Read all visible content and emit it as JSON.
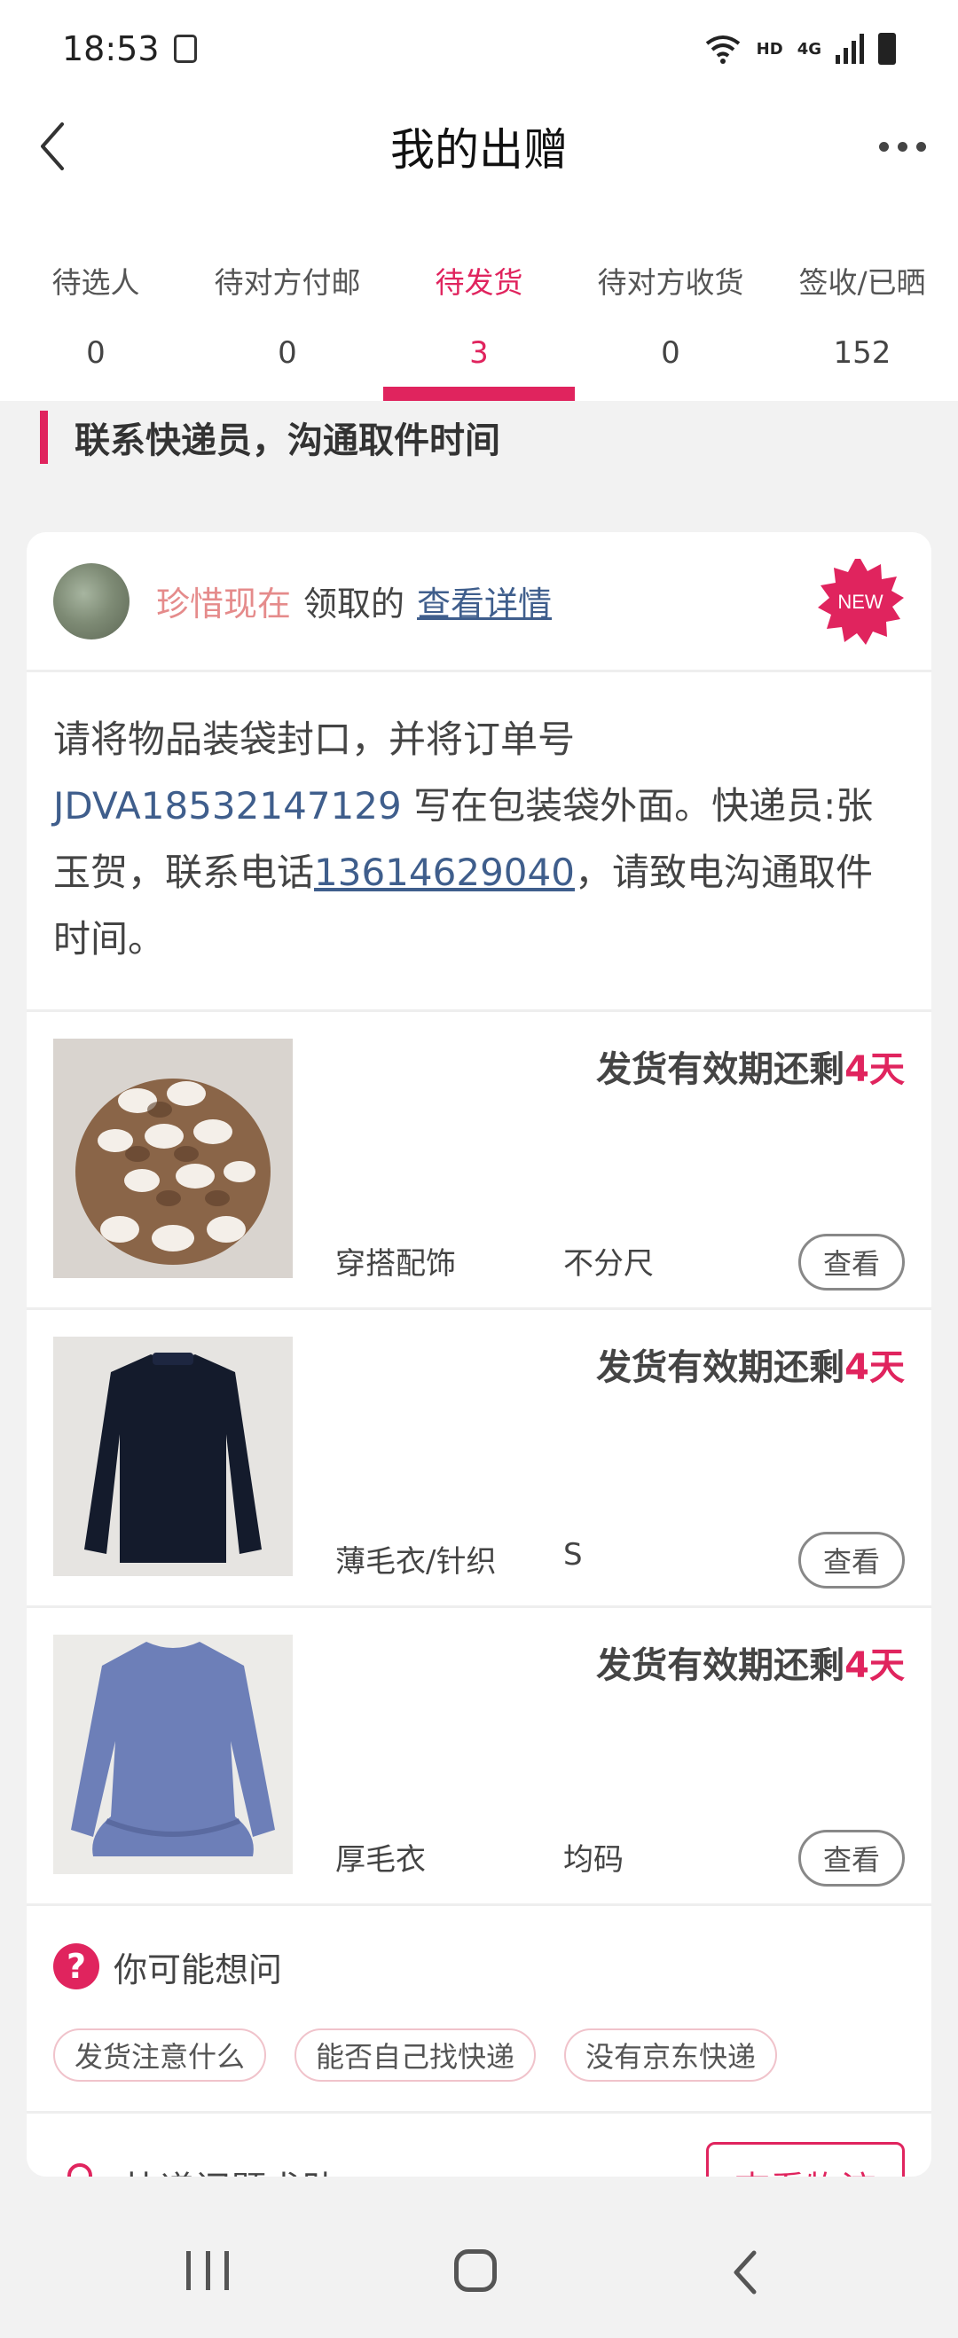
{
  "status_bar": {
    "time": "18:53",
    "hd": "HD",
    "network": "4G"
  },
  "header": {
    "title": "我的出赠"
  },
  "tabs": [
    {
      "label": "待选人",
      "count": "0"
    },
    {
      "label": "待对方付邮",
      "count": "0"
    },
    {
      "label": "待发货",
      "count": "3"
    },
    {
      "label": "待对方收货",
      "count": "0"
    },
    {
      "label": "签收/已晒",
      "count": "152"
    }
  ],
  "section": {
    "title": "联系快递员，沟通取件时间"
  },
  "card": {
    "giver_name": "珍惜现在",
    "giver_verb": "领取的",
    "detail_link": "查看详情",
    "new_badge": "NEW",
    "instruction": {
      "part1": "请将物品装袋封口，并将订单号 ",
      "order_no": "JDVA18532147129",
      "part2": " 写在包装袋外面。快递员:张玉贺，联系电话",
      "phone": "13614629040",
      "part3": "，请致电沟通取件时间。"
    },
    "items": [
      {
        "deadline_prefix": "发货有效期还剩",
        "deadline_days": "4天",
        "category": "穿搭配饰",
        "size": "不分尺",
        "view_label": "查看"
      },
      {
        "deadline_prefix": "发货有效期还剩",
        "deadline_days": "4天",
        "category": "薄毛衣/针织",
        "size": "S",
        "view_label": "查看"
      },
      {
        "deadline_prefix": "发货有效期还剩",
        "deadline_days": "4天",
        "category": "厚毛衣",
        "size": "均码",
        "view_label": "查看"
      }
    ],
    "faq": {
      "title": "你可能想问",
      "chips": [
        "发货注意什么",
        "能否自己找快递",
        "没有京东快递"
      ]
    },
    "help": {
      "label": "快递问题求助",
      "button": "查看物流"
    }
  },
  "colors": {
    "accent": "#e0245e",
    "link": "#3f5e8c",
    "giver_name": "#e58b8b"
  }
}
